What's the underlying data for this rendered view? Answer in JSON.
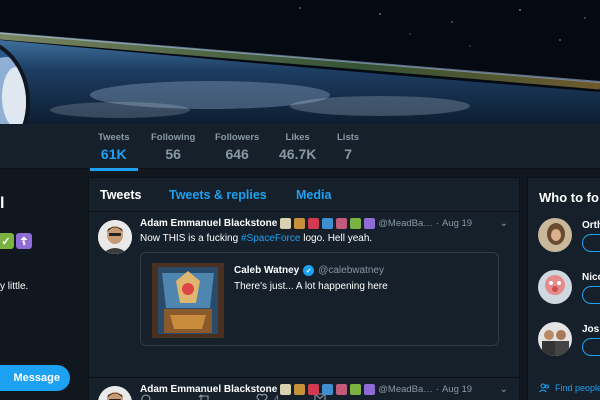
{
  "profile": {
    "name_fragment": "l",
    "bio_fragment": "y little.",
    "message_button": "Message",
    "emoji_colors": [
      "#7bb342",
      "#8f6bd6"
    ]
  },
  "stats": [
    {
      "label": "Tweets",
      "value": "61K",
      "active": true
    },
    {
      "label": "Following",
      "value": "56"
    },
    {
      "label": "Followers",
      "value": "646"
    },
    {
      "label": "Likes",
      "value": "46.7K"
    },
    {
      "label": "Lists",
      "value": "7"
    }
  ],
  "tabs": [
    {
      "label": "Tweets",
      "active": true
    },
    {
      "label": "Tweets & replies"
    },
    {
      "label": "Media"
    }
  ],
  "tweets": [
    {
      "author": "Adam Emmanuel Blackstone",
      "handle": "@MeadBa…",
      "dot": "·",
      "date": "Aug 19",
      "text_before": "Now THIS is a fucking ",
      "hashtag": "#SpaceForce",
      "text_after": " logo. Hell yeah.",
      "quote": {
        "author": "Caleb Watney",
        "handle": "@calebwatney",
        "text": "There's just... A lot happening here"
      },
      "likes": "4"
    },
    {
      "author": "Adam Emmanuel Blackstone",
      "handle": "@MeadBa…",
      "dot": "·",
      "date": "Aug 19"
    }
  ],
  "sidebar": {
    "title": "Who to fo",
    "suggestions": [
      {
        "name": "Orth"
      },
      {
        "name": "Nico"
      },
      {
        "name": "Jos"
      }
    ],
    "find_people": "Find people"
  },
  "colors": {
    "accent": "#1da1f2",
    "background": "#10171e",
    "panel": "#15202b",
    "muted": "#8899a6"
  }
}
